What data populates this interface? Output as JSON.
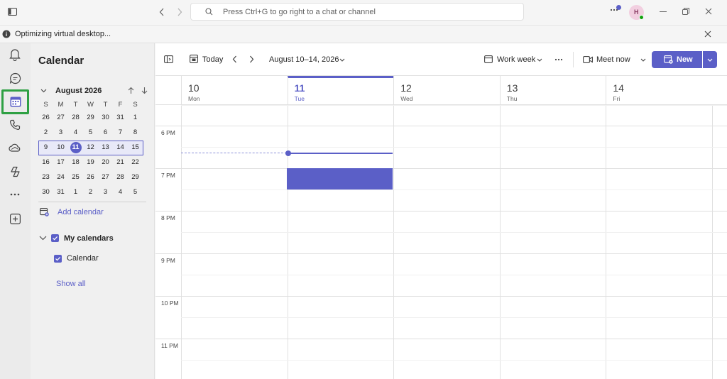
{
  "titlebar": {
    "search_placeholder": "Press Ctrl+G to go right to a chat or channel",
    "avatar_initial": "H"
  },
  "banner": {
    "text": "Optimizing virtual desktop..."
  },
  "nav": {
    "title": "Calendar",
    "month": "August 2026",
    "dow": [
      "S",
      "M",
      "T",
      "W",
      "T",
      "F",
      "S"
    ],
    "weeks": [
      [
        "26",
        "27",
        "28",
        "29",
        "30",
        "31",
        "1"
      ],
      [
        "2",
        "3",
        "4",
        "5",
        "6",
        "7",
        "8"
      ],
      [
        "9",
        "10",
        "11",
        "12",
        "13",
        "14",
        "15"
      ],
      [
        "16",
        "17",
        "18",
        "19",
        "20",
        "21",
        "22"
      ],
      [
        "23",
        "24",
        "25",
        "26",
        "27",
        "28",
        "29"
      ],
      [
        "30",
        "31",
        "1",
        "2",
        "3",
        "4",
        "5"
      ]
    ],
    "add_calendar": "Add calendar",
    "my_calendars": "My calendars",
    "calendar_item": "Calendar",
    "show_all": "Show all"
  },
  "toolbar": {
    "today": "Today",
    "date_range": "August 10–14, 2026",
    "view": "Work week",
    "meet_now": "Meet now",
    "new": "New"
  },
  "days": [
    {
      "num": "10",
      "name": "Mon"
    },
    {
      "num": "11",
      "name": "Tue"
    },
    {
      "num": "12",
      "name": "Wed"
    },
    {
      "num": "13",
      "name": "Thu"
    },
    {
      "num": "14",
      "name": "Fri"
    }
  ],
  "hours": [
    "6 PM",
    "7 PM",
    "8 PM",
    "9 PM",
    "10 PM",
    "11 PM"
  ],
  "colors": {
    "accent": "#5b5fc7",
    "rail_highlight": "#2ea043"
  }
}
